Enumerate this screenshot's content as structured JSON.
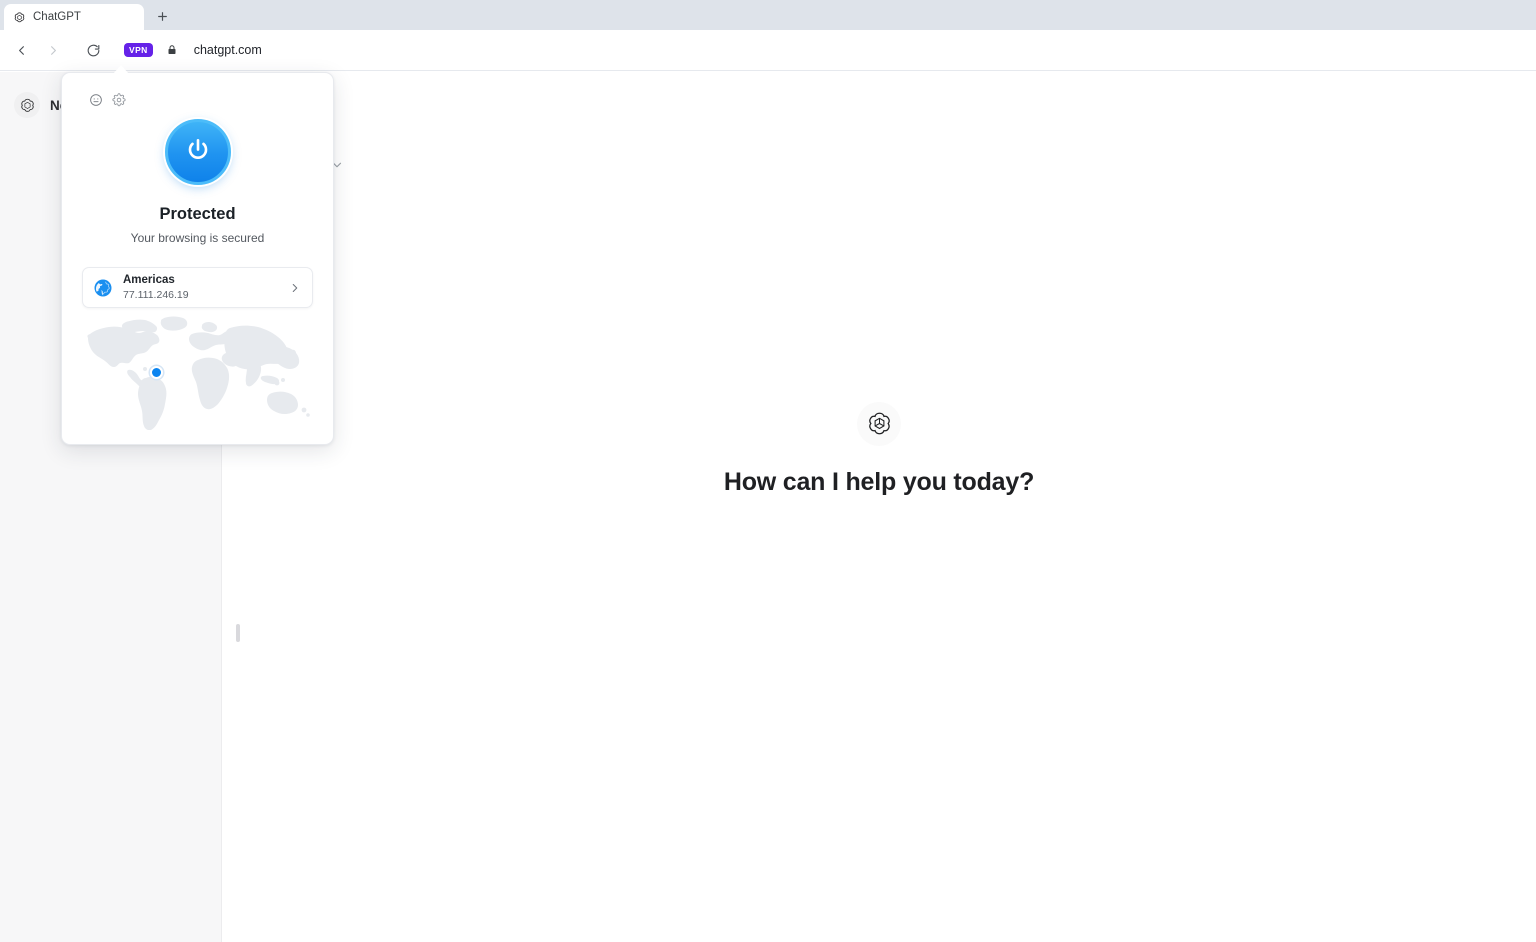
{
  "browser": {
    "tab": {
      "title": "ChatGPT",
      "favicon": "openai-logo-icon"
    },
    "new_tab_label": "+",
    "toolbar": {
      "back_icon": "back-arrow-icon",
      "forward_icon": "forward-arrow-icon",
      "reload_icon": "reload-icon",
      "vpn_badge_label": "VPN",
      "vpn_badge_color": "#6522e8",
      "lock_icon": "lock-icon",
      "url": "chatgpt.com"
    }
  },
  "page": {
    "sidebar": {
      "new_chat_label": "New chat",
      "logo_icon": "openai-logo-icon"
    },
    "model_selector_icon": "chevron-down-icon",
    "main": {
      "logo_icon": "openai-logo-icon",
      "greeting": "How can I help you today?"
    }
  },
  "vpn_popup": {
    "header": {
      "smiley_icon": "smiley-face-icon",
      "settings_icon": "gear-icon"
    },
    "power_button": {
      "icon": "power-icon",
      "state": "on",
      "color": "#1f93f0"
    },
    "status_title": "Protected",
    "status_subtitle": "Your browsing is secured",
    "location": {
      "globe_icon": "globe-icon",
      "region": "Americas",
      "ip_address": "77.111.246.19",
      "chevron_icon": "chevron-right-icon"
    },
    "map": {
      "marker_icon": "location-dot-icon",
      "marker_color": "#0a84f0"
    }
  }
}
